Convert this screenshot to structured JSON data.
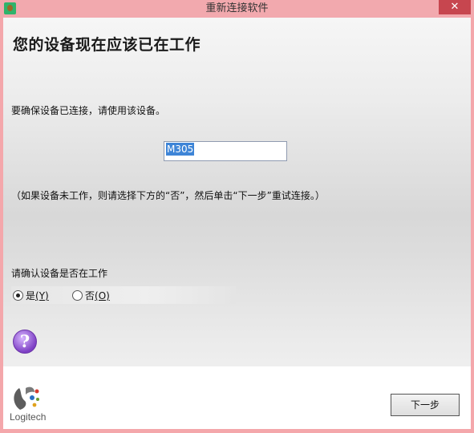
{
  "window": {
    "title": "重新连接软件",
    "close_label": "✕"
  },
  "content": {
    "heading": "您的设备现在应该已在工作",
    "line1": "要确保设备已连接，请使用该设备。",
    "device_name": "M305",
    "hint": "（如果设备未工作，则请选择下方的“否”，然后单击“下一步”重试连接。）",
    "confirm_label": "请确认设备是否在工作",
    "radio_yes": {
      "label": "是",
      "shortcut": "(Y)"
    },
    "radio_no": {
      "label": "否",
      "shortcut": "(O)"
    },
    "help_icon": "?"
  },
  "footer": {
    "brand": "Logitech",
    "next_label": "下一步"
  },
  "colors": {
    "frame": "#f4a7ab",
    "close": "#c7464f",
    "selection": "#3e85d7",
    "help": "#7d3fc4"
  },
  "icons": [
    "app-icon",
    "close-icon",
    "help-icon",
    "logitech-logo"
  ]
}
